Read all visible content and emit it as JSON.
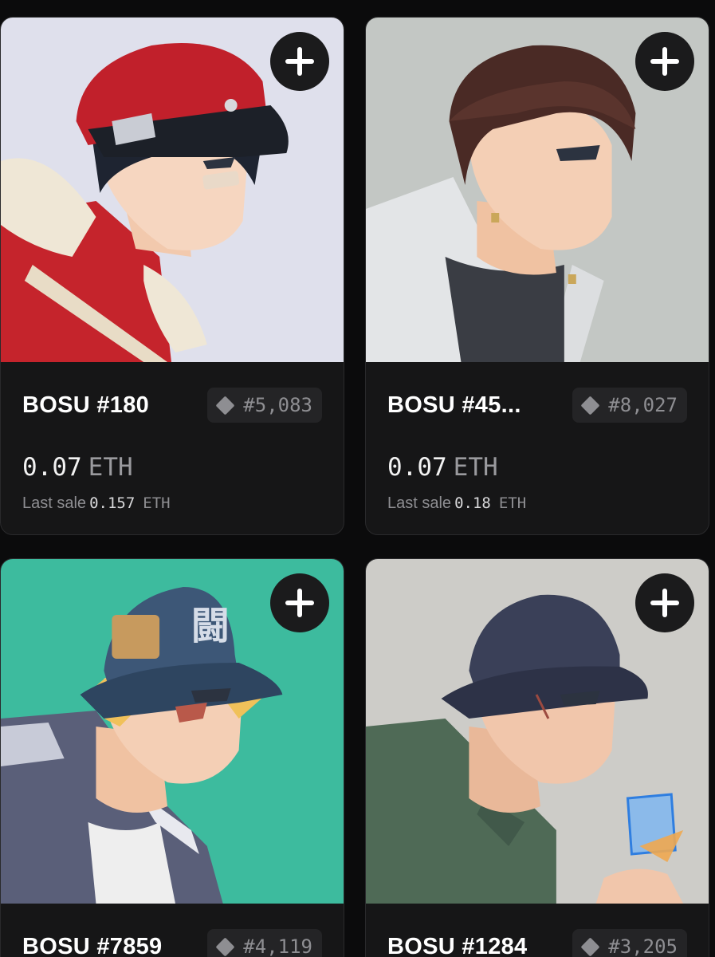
{
  "cards": [
    {
      "name": "BOSU #180",
      "rank": "#5,083",
      "price": "0.07",
      "price_unit": "ETH",
      "last_sale_label": "Last sale",
      "last_sale_value": "0.157",
      "last_sale_unit": "ETH",
      "bg_color": "#dfe0ec"
    },
    {
      "name": "BOSU #45...",
      "rank": "#8,027",
      "price": "0.07",
      "price_unit": "ETH",
      "last_sale_label": "Last sale",
      "last_sale_value": "0.18",
      "last_sale_unit": "ETH",
      "bg_color": "#c3c7c4"
    },
    {
      "name": "BOSU #7859",
      "rank": "#4,119",
      "bg_color": "#3dbb9e"
    },
    {
      "name": "BOSU #1284",
      "rank": "#3,205",
      "bg_color": "#cdccc8"
    }
  ],
  "icons": {
    "add": "plus-icon",
    "rank": "diamond-icon"
  }
}
